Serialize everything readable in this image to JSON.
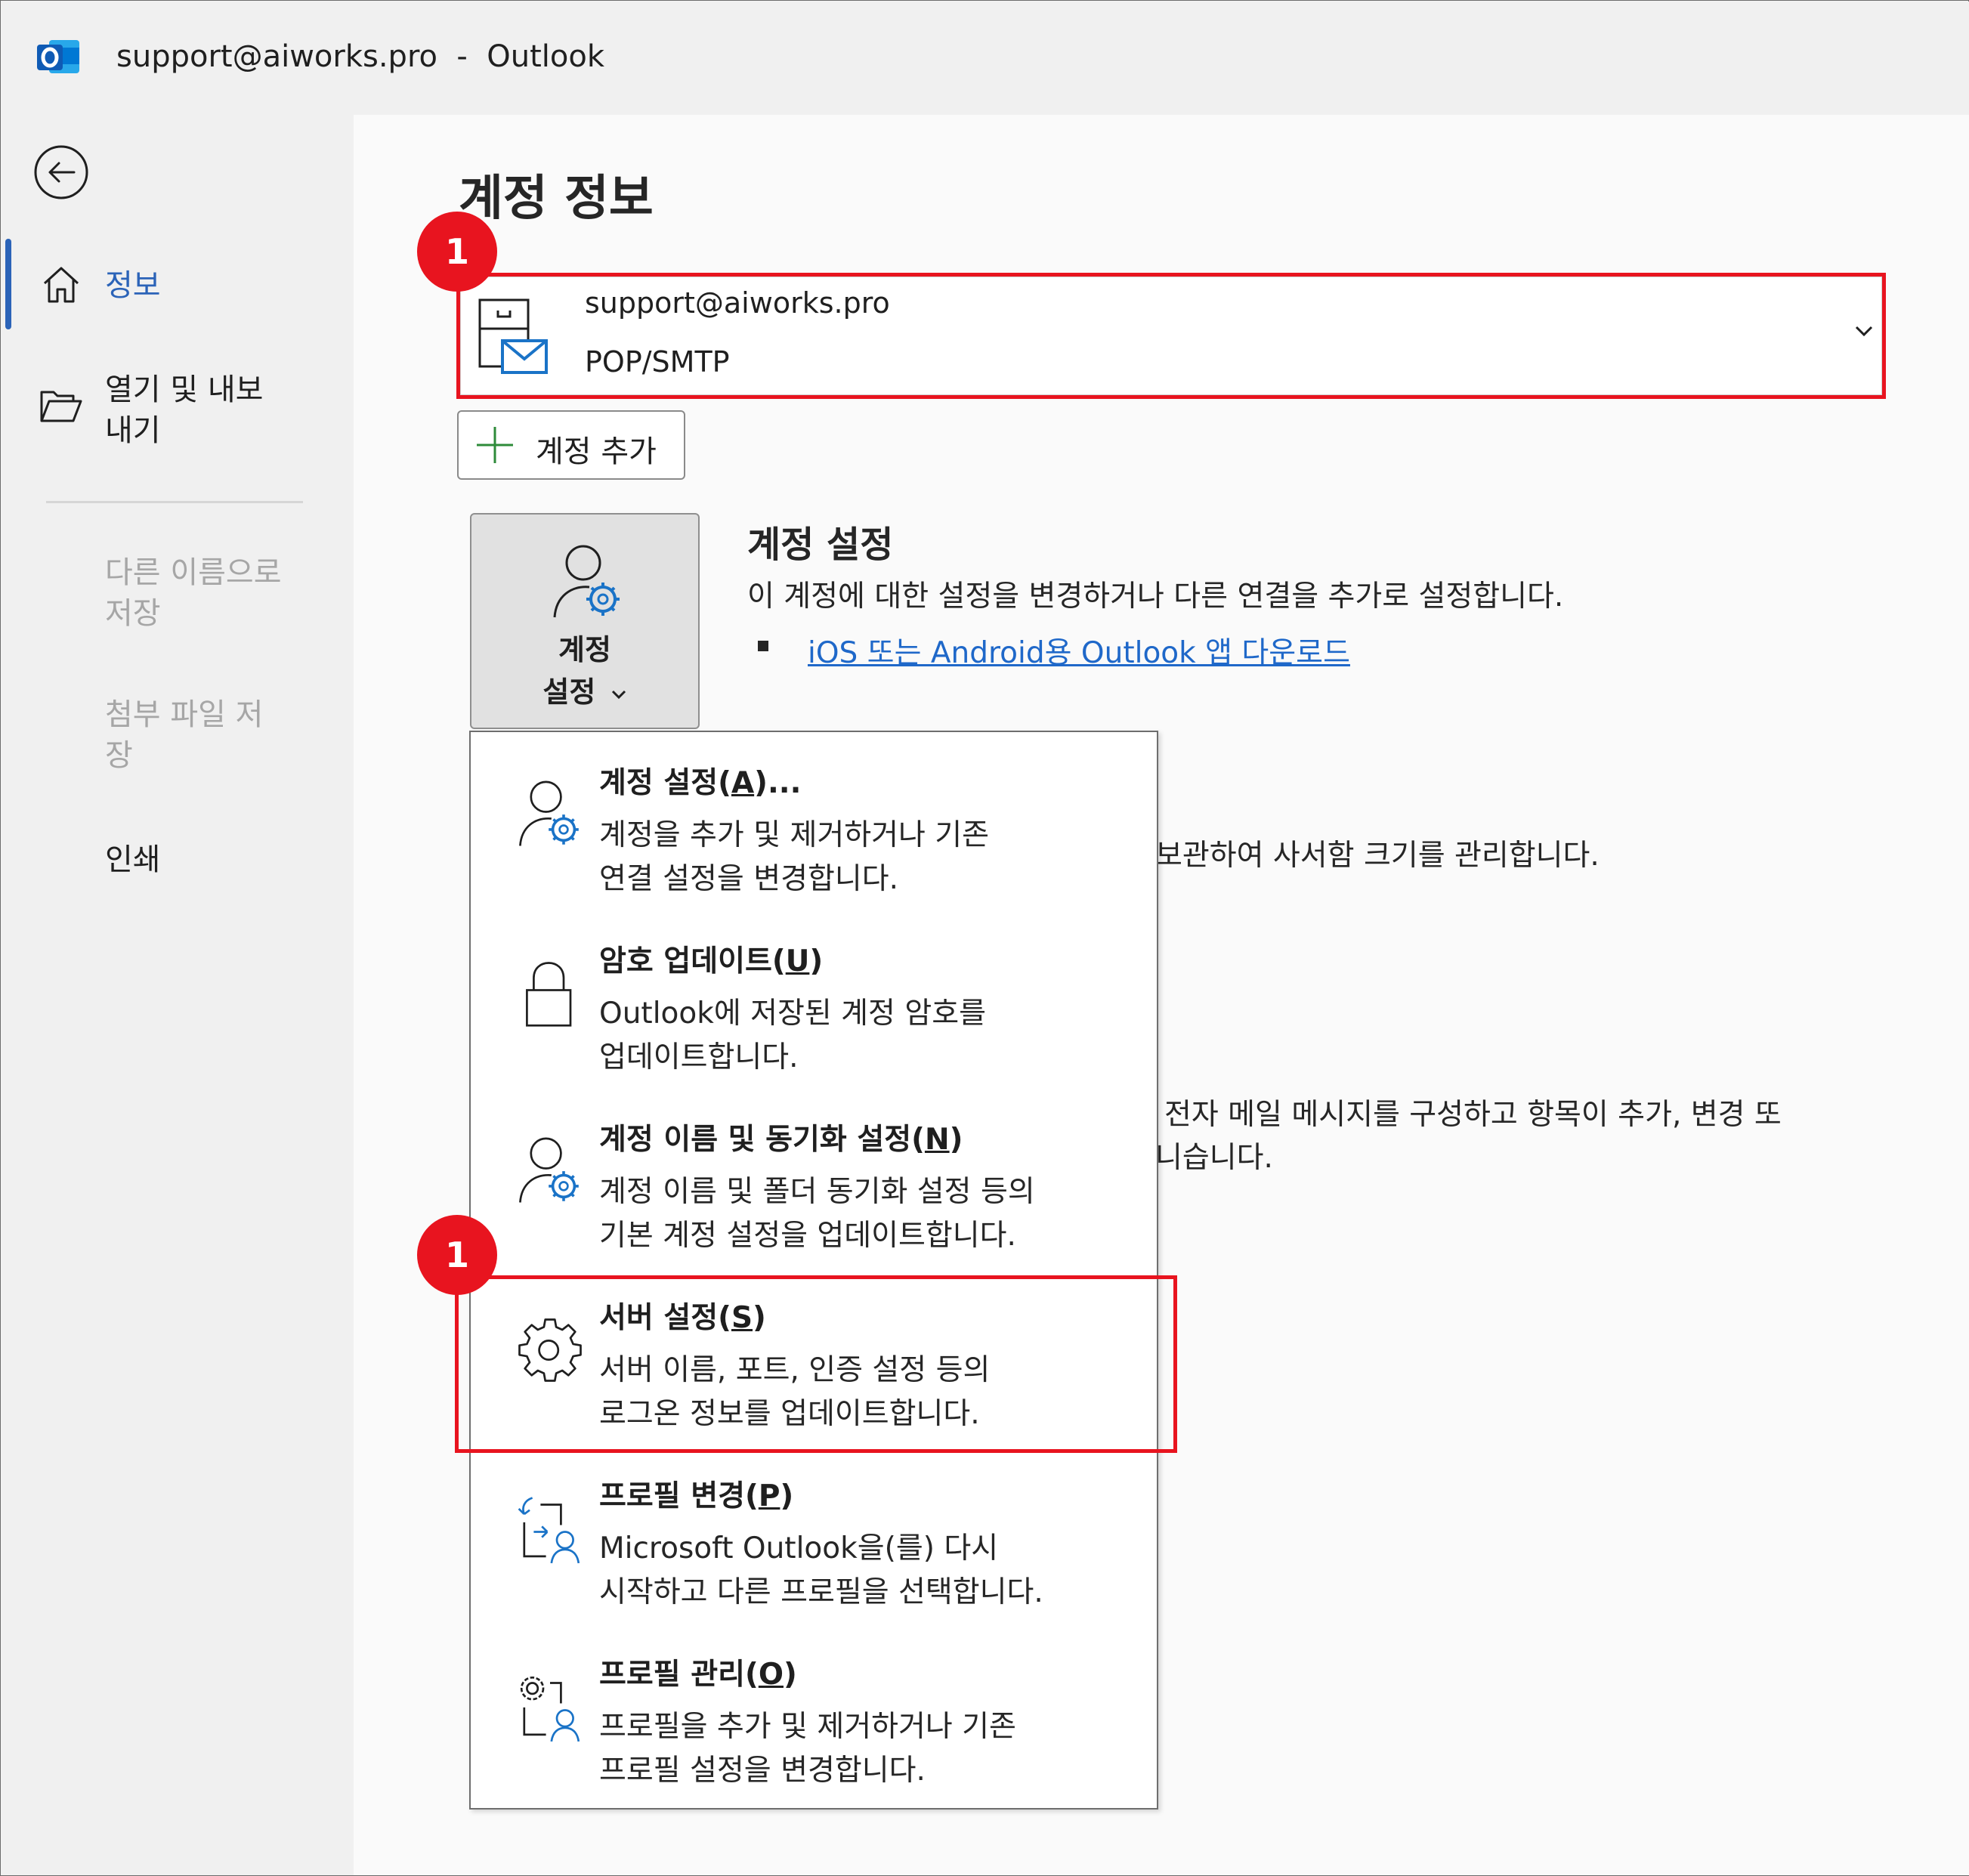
{
  "window": {
    "title": "support@aiworks.pro  -  Outlook"
  },
  "sidebar": {
    "back_icon": "back-arrow-icon",
    "items": [
      {
        "label": "정보",
        "icon": "home-icon",
        "state": "active"
      },
      {
        "label_line1": "열기 및 내보",
        "label_line2": "내기",
        "icon": "folder-open-icon",
        "state": "normal"
      },
      {
        "label_line1": "다른 이름으로",
        "label_line2": "저장",
        "state": "disabled"
      },
      {
        "label_line1": "첨부 파일 저",
        "label_line2": "장",
        "state": "disabled"
      },
      {
        "label": "인쇄",
        "state": "normal"
      }
    ]
  },
  "main": {
    "page_title": "계정 정보",
    "account": {
      "email": "support@aiworks.pro",
      "type": "POP/SMTP",
      "icon": "mailbox-icon"
    },
    "add_account_label": "계정 추가",
    "settings_tile": {
      "line1": "계정",
      "line2": "설정",
      "icon": "account-settings-icon"
    },
    "section": {
      "title": "계정 설정",
      "desc": "이 계정에 대한 설정을 변경하거나 다른 연결을 추가로 설정합니다.",
      "link": "iOS 또는 Android용 Outlook 앱 다운로드"
    },
    "bg_text_1": "보관하여 사서함 크기를 관리합니다.",
    "bg_text_2": "전자 메일 메시지를 구성하고 항목이 추가, 변경 또",
    "bg_text_3": "니습니다."
  },
  "menu": {
    "items": [
      {
        "title": "계정 설정(",
        "key": "A",
        "suffix": ")...",
        "desc_line1": "계정을 추가 및 제거하거나 기존",
        "desc_line2": "연결 설정을 변경합니다.",
        "icon": "account-settings-icon"
      },
      {
        "title": "암호 업데이트(",
        "key": "U",
        "suffix": ")",
        "desc_line1": "Outlook에 저장된 계정 암호를",
        "desc_line2": "업데이트합니다.",
        "icon": "lock-icon"
      },
      {
        "title": "계정 이름 및 동기화 설정(",
        "key": "N",
        "suffix": ")",
        "desc_line1": "계정 이름 및 폴더 동기화 설정 등의",
        "desc_line2": "기본 계정 설정을 업데이트합니다.",
        "icon": "account-settings-icon"
      },
      {
        "title": "서버 설정(",
        "key": "S",
        "suffix": ")",
        "desc_line1": "서버 이름, 포트, 인증 설정 등의",
        "desc_line2": "로그온 정보를 업데이트합니다.",
        "icon": "gear-icon"
      },
      {
        "title": "프로필 변경(",
        "key": "P",
        "suffix": ")",
        "desc_line1": "Microsoft Outlook을(를) 다시",
        "desc_line2": "시작하고 다른 프로필을 선택합니다.",
        "icon": "profile-switch-icon"
      },
      {
        "title": "프로필 관리(",
        "key": "O",
        "suffix": ")",
        "desc_line1": "프로필을 추가 및 제거하거나 기존",
        "desc_line2": "프로필 설정을 변경합니다.",
        "icon": "profile-manage-icon"
      }
    ]
  },
  "annotations": {
    "callout_1": "1",
    "callout_2": "1",
    "accent_color": "#e8141f"
  }
}
